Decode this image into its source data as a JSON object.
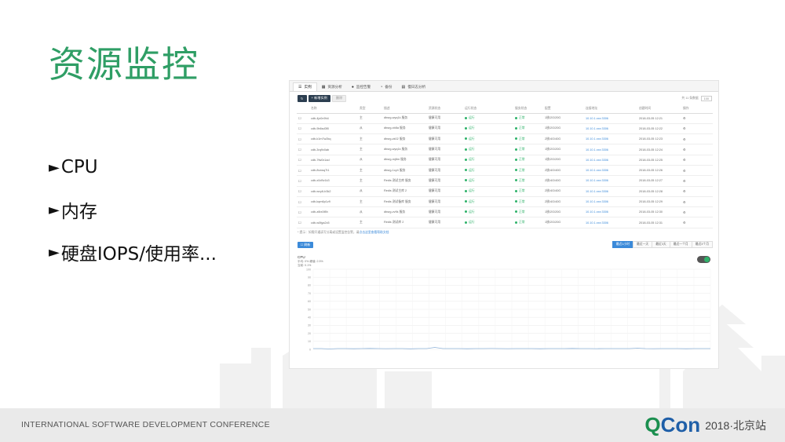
{
  "slide": {
    "title": "资源监控",
    "bullets": [
      "CPU",
      "内存",
      "硬盘IOPS/使用率..."
    ],
    "bullet_marker": "►",
    "footer_conference": "INTERNATIONAL SOFTWARE DEVELOPMENT CONFERENCE",
    "brand_q": "Q",
    "brand_con": "Con",
    "brand_city": "2018·北京站",
    "colors": {
      "title": "#2f9e65",
      "brand_green": "#1b8f4f",
      "brand_blue": "#1f5fa8",
      "footer_bg": "#eaeaea"
    }
  },
  "app": {
    "tabs": [
      {
        "icon": "list-icon",
        "glyph": "☰",
        "label": "实例"
      },
      {
        "icon": "grid-icon",
        "glyph": "▦",
        "label": "资源分析"
      },
      {
        "icon": "user-icon",
        "glyph": "●",
        "label": "监控告警"
      },
      {
        "icon": "gauge-icon",
        "glyph": "◔",
        "label": "备份"
      },
      {
        "icon": "gauge-icon",
        "glyph": "▤",
        "label": "慢日志分析"
      }
    ],
    "toolbar": {
      "refresh_glyph": "↻",
      "add_label": "+ 新增实例",
      "delete_label": "删除"
    },
    "pagination": {
      "text": "共 11 条数据",
      "page_size": "100"
    },
    "table": {
      "headers": [
        "",
        "名称",
        "类型",
        "描述",
        "资源状态",
        "运行状态",
        "服务状态",
        "配置",
        "连接地址",
        "创建时间",
        "操作"
      ],
      "rows": [
        [
          "cdb-4jx0n9h4",
          "主",
          "dbsrg-wyq1k 服务",
          "健康可用",
          "运行",
          "正常",
          "1核/2G/20G",
          "10.10.1.xxx:3306",
          "2018-03-05 12:21",
          "⚙"
        ],
        [
          "cdb-9b6sd3f0",
          "从",
          "dbsrg-xb8a 服务",
          "健康可用",
          "运行",
          "正常",
          "1核/2G/20G",
          "10.10.1.xxx:3306",
          "2018-03-05 12:22",
          "⚙"
        ],
        [
          "cdb-k1m7w2kq",
          "主",
          "dbsrg-zk02 服务",
          "健康可用",
          "运行",
          "正常",
          "2核/4G/40G",
          "10.10.1.xxx:3306",
          "2018-03-05 12:23",
          "⚙"
        ],
        [
          "cdb-3rq9x0ab",
          "主",
          "dbsrg-wyq1k 服务",
          "健康可用",
          "运行",
          "正常",
          "1核/2G/20G",
          "10.10.1.xxx:3306",
          "2018-03-05 12:24",
          "⚙"
        ],
        [
          "cdb-7fw0x1ad",
          "从",
          "dbsrg-mj8m 服务",
          "健康可用",
          "运行",
          "正常",
          "1核/2G/20G",
          "10.10.1.xxx:3306",
          "2018-03-05 12:25",
          "⚙"
        ],
        [
          "cdb-8vxwq7t1",
          "主",
          "dbsrg-1cy4 服务",
          "健康可用",
          "运行",
          "正常",
          "2核/4G/40G",
          "10.10.1.xxx:3306",
          "2018-03-05 12:26",
          "⚙"
        ],
        [
          "cdb-x0d9v1k3",
          "主",
          "Redis 测试主库 服务",
          "健康可用",
          "运行",
          "正常",
          "2核/4G/40G",
          "10.10.1.xxx:3306",
          "2018-03-05 12:27",
          "⚙"
        ],
        [
          "cdb-wvy6-b3k2",
          "从",
          "Redis 测试主库 2",
          "健康可用",
          "运行",
          "正常",
          "2核/4G/40G",
          "10.10.1.xxx:3306",
          "2018-03-05 12:28",
          "⚙"
        ],
        [
          "cdb-kqm6p1z9",
          "主",
          "Redis 测试备库 服务",
          "健康可用",
          "运行",
          "正常",
          "2核/4G/40G",
          "10.10.1.xxx:3306",
          "2018-03-05 12:29",
          "⚙"
        ],
        [
          "cdb-z6tx0f8h",
          "从",
          "dbsrg-vv9k 服务",
          "健康可用",
          "运行",
          "正常",
          "1核/2G/20G",
          "10.10.1.xxx:3306",
          "2018-03-05 12:30",
          "⚙"
        ],
        [
          "cdb-w0fga2c5",
          "主",
          "Redis 测试库 2",
          "健康可用",
          "运行",
          "正常",
          "1核/2G/20G",
          "10.10.1.xxx:3306",
          "2018-03-05 12:31",
          "⚙"
        ]
      ]
    },
    "hint": {
      "text": "* 提示：如需开通读写分离或设置监控告警，请",
      "link": "点击这里查看帮助文档"
    },
    "monitor": {
      "button_label": "☐ 刷新",
      "ranges": [
        "最近1小时",
        "最近一天",
        "最近3天",
        "最近一个月",
        "最近3个月"
      ],
      "active_range": 0,
      "cpu_title": "CPU",
      "cpu_meta_1": "平均: 0%   峰值: 2.5%",
      "cpu_meta_2": "当前: 0.1%",
      "colors": {
        "accent": "#3b8ad9",
        "status_green": "#2fb26a",
        "line": "#8fb3d9"
      }
    }
  },
  "chart_data": {
    "type": "line",
    "title": "CPU",
    "ylim": [
      0,
      100
    ],
    "y_ticks": [
      0,
      10,
      20,
      30,
      40,
      50,
      60,
      70,
      80,
      90,
      100
    ],
    "grid": true,
    "series": [
      {
        "values": [
          1,
          1,
          0.5,
          1,
          1,
          0.8,
          1,
          1.2,
          1,
          0.9,
          1,
          1,
          0.7,
          1,
          1,
          2.5,
          1,
          1,
          1,
          0.8,
          1,
          1,
          1.1,
          1,
          0.9,
          1,
          1,
          1,
          0.8,
          1,
          1,
          1,
          1.2,
          1,
          1,
          0.9,
          1,
          1,
          1,
          1,
          1.5,
          1,
          0.9,
          1,
          1,
          1,
          0.8,
          1,
          1,
          1
        ]
      }
    ]
  }
}
